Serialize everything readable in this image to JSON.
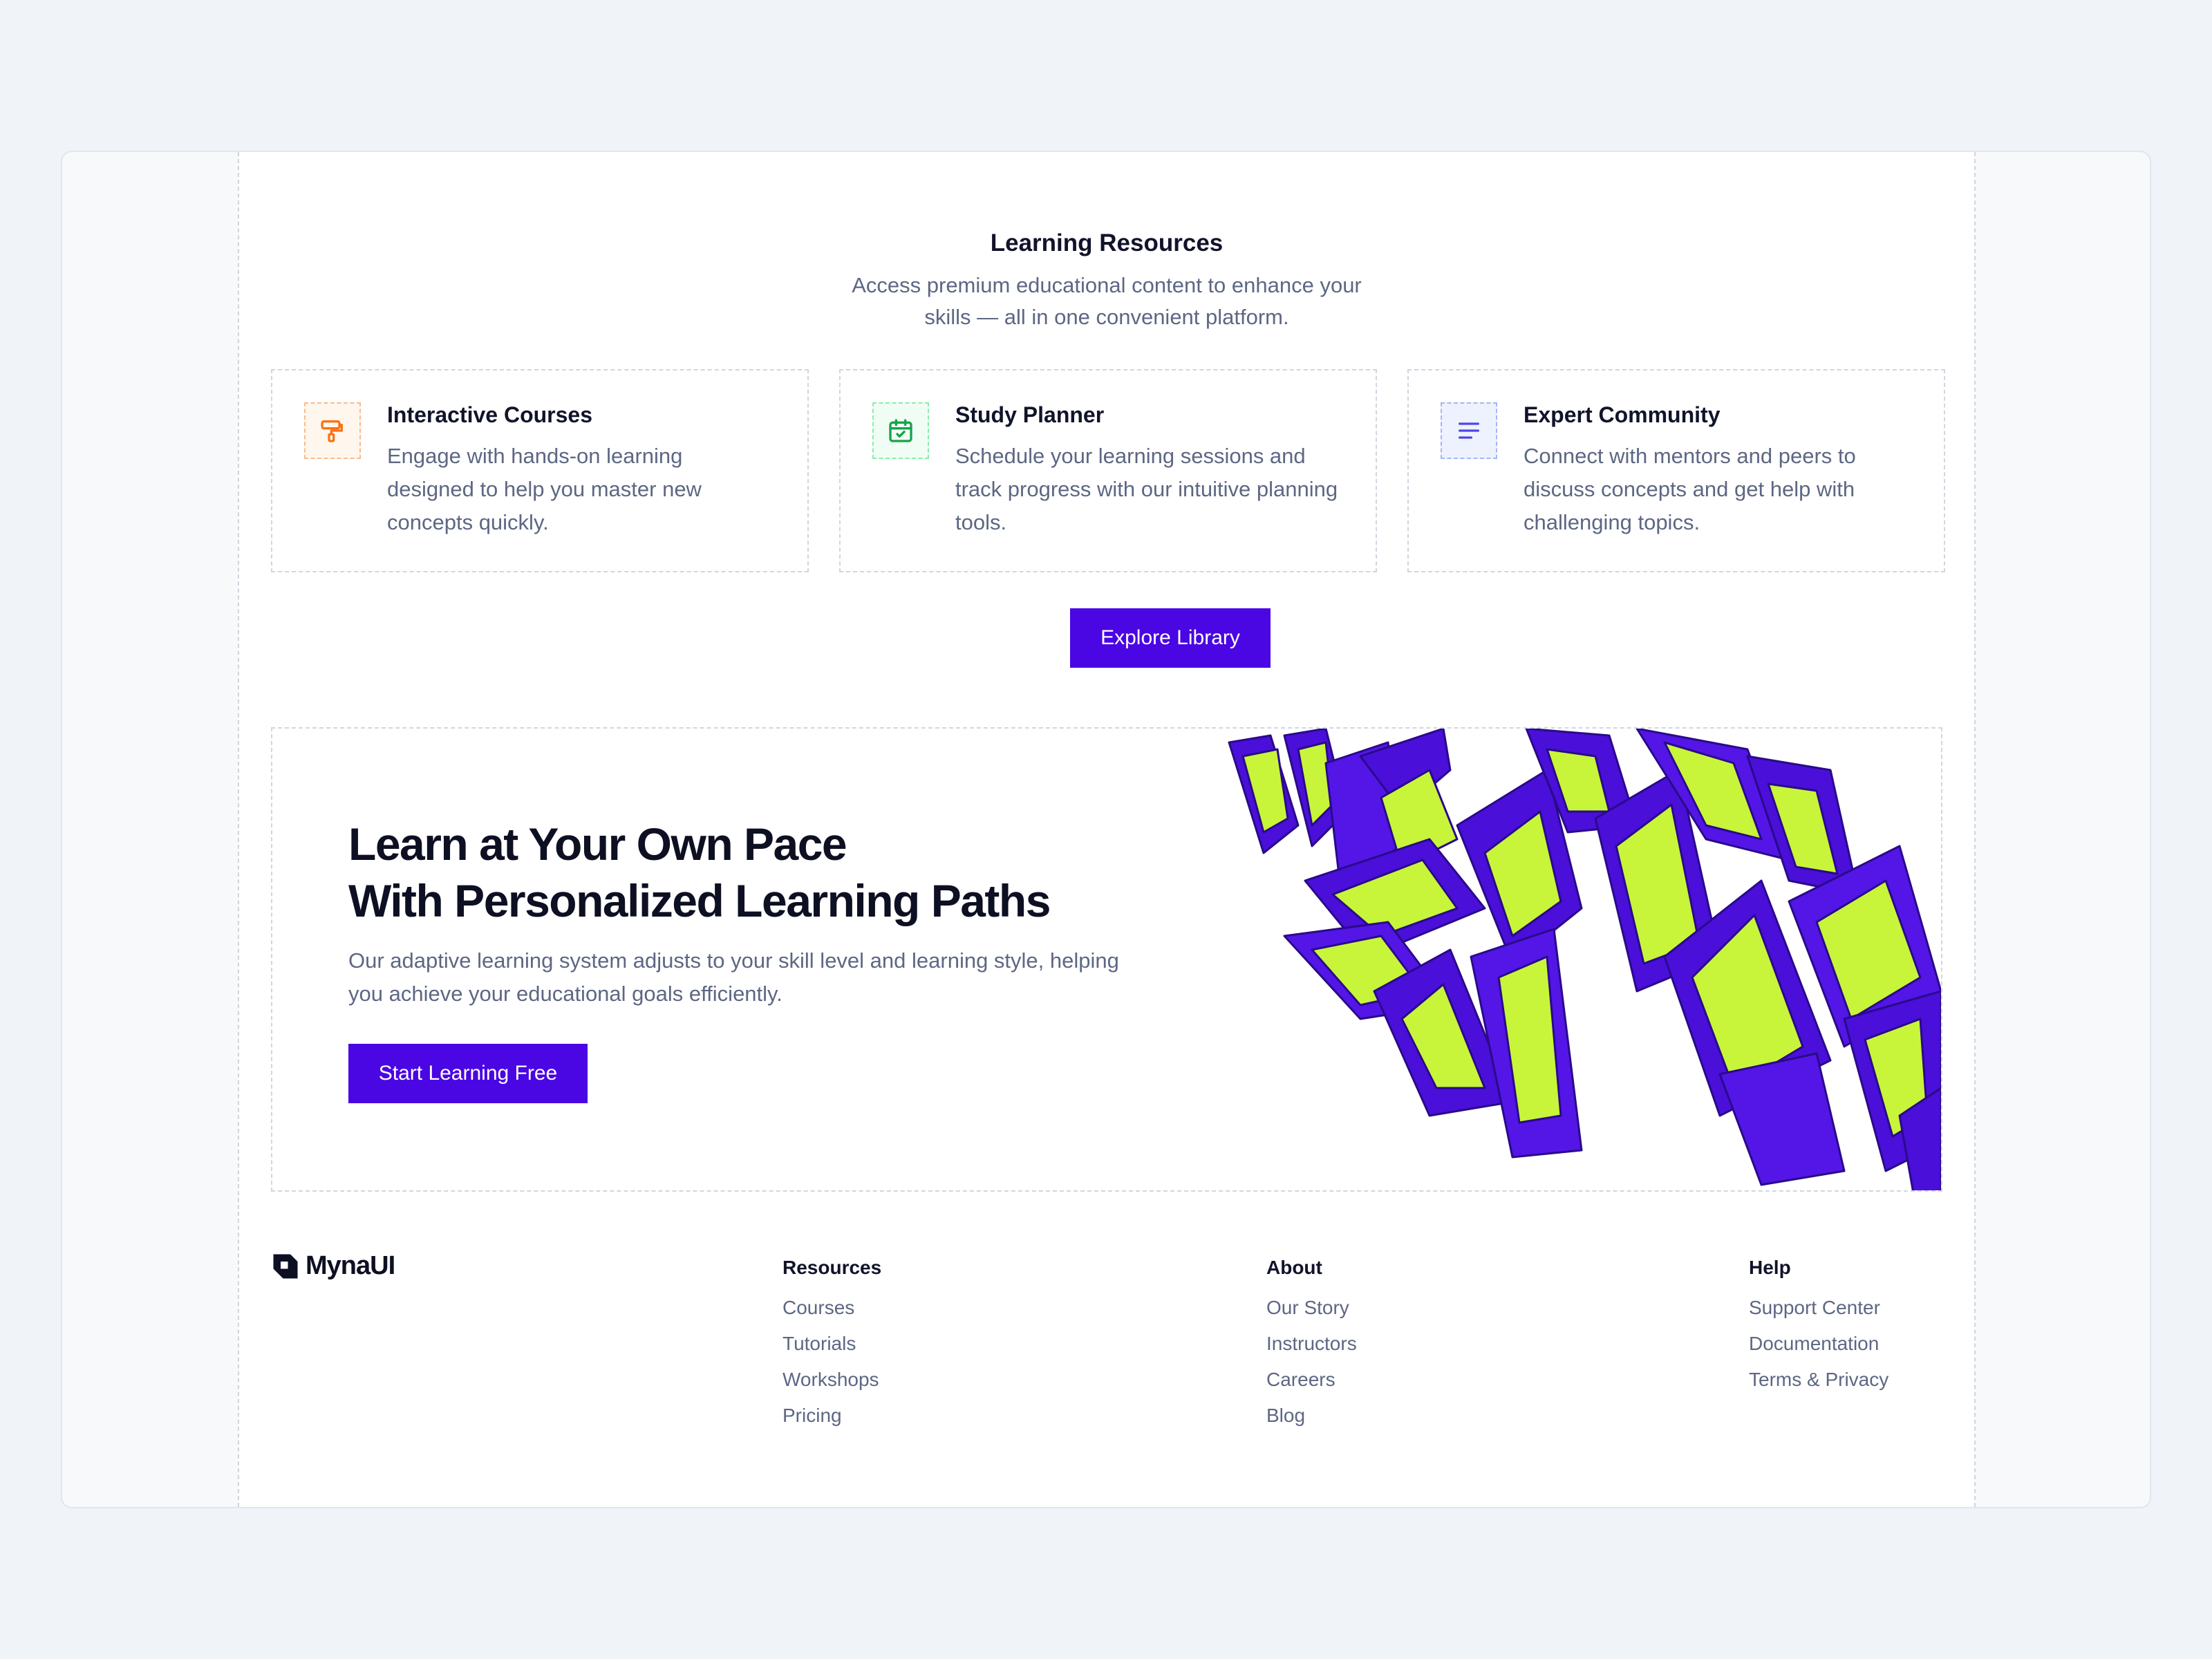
{
  "resources": {
    "title": "Learning Resources",
    "subtitle": "Access premium educational content to enhance your skills — all in one convenient platform.",
    "cards": [
      {
        "title": "Interactive Courses",
        "description": "Engage with hands-on learning designed to help you master new concepts quickly.",
        "icon": "paint-roller-icon",
        "accent": "#f97316"
      },
      {
        "title": "Study Planner",
        "description": "Schedule your learning sessions and track progress with our intuitive planning tools.",
        "icon": "calendar-check-icon",
        "accent": "#16a34a"
      },
      {
        "title": "Expert Community",
        "description": "Connect with mentors and peers to discuss concepts and get help with challenging topics.",
        "icon": "text-lines-icon",
        "accent": "#4f46e5"
      }
    ],
    "button_label": "Explore Library"
  },
  "cta": {
    "heading_line1": "Learn at Your Own Pace",
    "heading_line2": "With Personalized Learning Paths",
    "description": "Our adaptive learning system adjusts to your skill level and learning style, helping you achieve your educational goals efficiently.",
    "button_label": "Start Learning Free",
    "art_colors": [
      "#4a0fd9",
      "#c8f53a"
    ]
  },
  "footer": {
    "brand": "MynaUI",
    "columns": [
      {
        "title": "Resources",
        "links": [
          "Courses",
          "Tutorials",
          "Workshops",
          "Pricing"
        ]
      },
      {
        "title": "About",
        "links": [
          "Our Story",
          "Instructors",
          "Careers",
          "Blog"
        ]
      },
      {
        "title": "Help",
        "links": [
          "Support Center",
          "Documentation",
          "Terms & Privacy"
        ]
      }
    ]
  },
  "theme": {
    "primary": "#4a06e3",
    "muted_text": "#5d6783"
  }
}
